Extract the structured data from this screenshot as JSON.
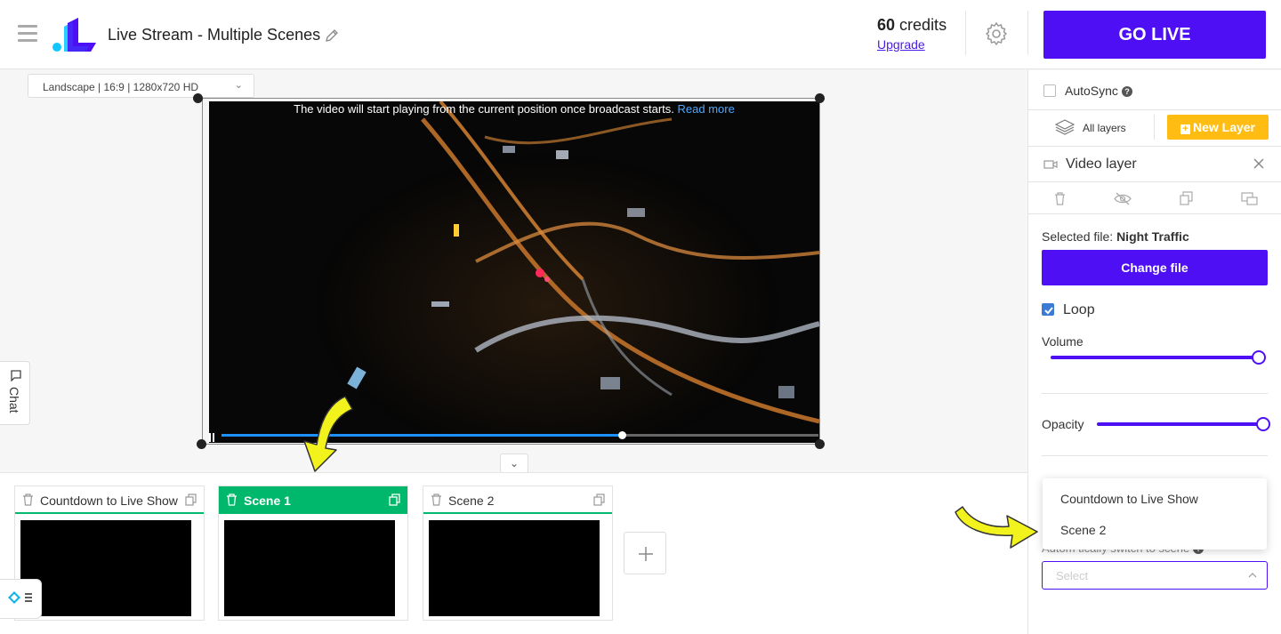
{
  "header": {
    "title": "Live Stream - Multiple Scenes",
    "credits_value": "60",
    "credits_label": "credits",
    "upgrade_label": "Upgrade",
    "go_live_label": "GO LIVE"
  },
  "canvas": {
    "resolution": "Landscape | 16:9 | 1280x720 HD",
    "notice_text": "The video will start playing from the current position once broadcast starts.",
    "notice_link": "Read more",
    "playback_progress": 0.67,
    "chat_label": "Chat"
  },
  "scenes": [
    {
      "name": "Countdown to Live Show",
      "active": false
    },
    {
      "name": "Scene 1",
      "active": true
    },
    {
      "name": "Scene 2",
      "active": false
    }
  ],
  "panel": {
    "autosync_label": "AutoSync",
    "all_layers_label": "All layers",
    "new_layer_label": "New Layer",
    "layer_title": "Video layer",
    "selected_file_label": "Selected file:",
    "selected_file_name": "Night Traffic",
    "change_file_label": "Change file",
    "loop_label": "Loop",
    "loop_checked": true,
    "volume_label": "Volume",
    "volume_value": 1.0,
    "opacity_label": "Opacity",
    "opacity_value": 1.0,
    "auto_switch_label": "Autom   tically switch to scene",
    "select_placeholder": "Select",
    "dropdown_options": [
      "Countdown to Live Show",
      "Scene 2"
    ]
  },
  "colors": {
    "accent": "#4e0ff5",
    "active_scene": "#00b86b",
    "new_layer": "#ffbd14",
    "link": "#4b1de8"
  }
}
